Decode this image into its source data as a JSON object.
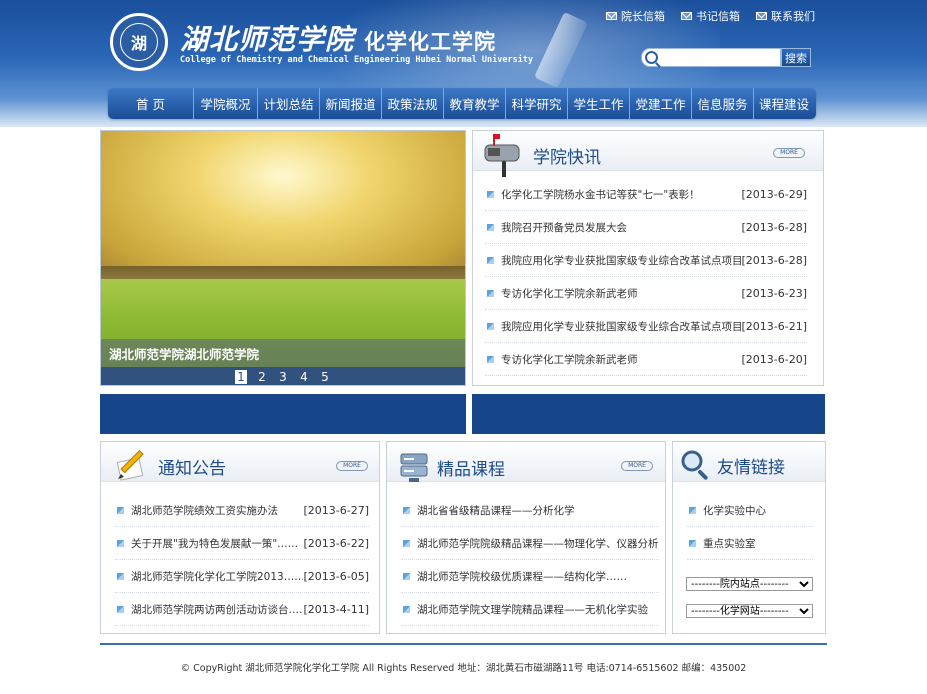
{
  "header": {
    "logo_text": "湖",
    "title": "湖北师范学院",
    "subtitle": "化学化工学院",
    "english": "College of Chemistry and Chemical Engineering Hubei Normal University",
    "top_links": [
      "院长信箱",
      "书记信箱",
      "联系我们"
    ],
    "search": {
      "placeholder": "",
      "button": "搜索"
    }
  },
  "nav": {
    "items": [
      "首 页",
      "学院概况",
      "计划总结",
      "新闻报道",
      "政策法规",
      "教育教学",
      "科学研究",
      "学生工作",
      "党建工作",
      "信息服务",
      "课程建设"
    ]
  },
  "banner": {
    "caption": "湖北师范学院湖北师范学院",
    "pages": [
      "1",
      "2",
      "3",
      "4",
      "5"
    ],
    "active_page": "1"
  },
  "news": {
    "title": "学院快讯",
    "more": "MORE",
    "items": [
      {
        "text": "化学化工学院杨水金书记等获\"七一\"表彰！",
        "date": "[2013-6-29]"
      },
      {
        "text": "我院召开预备党员发展大会",
        "date": "[2013-6-28]"
      },
      {
        "text": "我院应用化学专业获批国家级专业综合改革试点项目",
        "date": "[2013-6-28]"
      },
      {
        "text": "专访化学化工学院余新武老师",
        "date": "[2013-6-23]"
      },
      {
        "text": "我院应用化学专业获批国家级专业综合改革试点项目",
        "date": "[2013-6-21]"
      },
      {
        "text": "专访化学化工学院余新武老师",
        "date": "[2013-6-20]"
      }
    ]
  },
  "notice": {
    "title": "通知公告",
    "more": "MORE",
    "items": [
      {
        "text": "湖北师范学院绩效工资实施办法",
        "date": "[2013-6-27]"
      },
      {
        "text": "关于开展\"我为特色发展献一策\"……",
        "date": "[2013-6-22]"
      },
      {
        "text": "湖北师范学院化学化工学院2013……",
        "date": "[2013-6-05]"
      },
      {
        "text": "湖北师范学院两访两创活动访谈台……",
        "date": "[2013-4-11]"
      }
    ]
  },
  "courses": {
    "title": "精品课程",
    "more": "MORE",
    "items": [
      "湖北省省级精品课程——分析化学",
      "湖北师范学院院级精品课程——物理化学、仪器分析",
      "湖北师范学院校级优质课程——结构化学……",
      "湖北师范学院文理学院精品课程——无机化学实验"
    ]
  },
  "links": {
    "title": "友情链接",
    "items": [
      "化学实验中心",
      "重点实验室"
    ],
    "select1": "--------院内站点--------",
    "select2": "--------化学网站--------"
  },
  "footer": {
    "text": "© CopyRight  湖北师范学院化学化工学院    All Rights Reserved    地址：湖北黄石市磁湖路11号    电话:0714-6515602    邮编：435002"
  },
  "colors": {
    "primary": "#1b4d97",
    "accent": "#17458a",
    "title": "#1d4b8c"
  }
}
